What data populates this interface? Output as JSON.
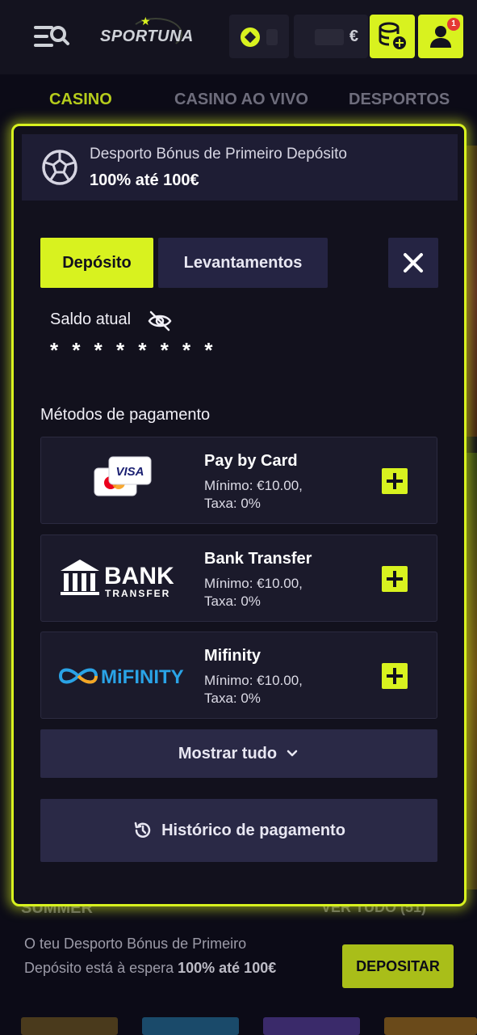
{
  "header": {
    "brand": "SPORTUNA",
    "balance_currency": "€",
    "notification_count": "1"
  },
  "nav": {
    "items": [
      "CASINO",
      "CASINO AO VIVO",
      "DESPORTOS"
    ],
    "active": "CASINO"
  },
  "modal": {
    "bonus": {
      "title": "Desporto Bónus de Primeiro Depósito",
      "value": "100% até 100€"
    },
    "tabs": {
      "deposit": "Depósito",
      "withdraw": "Levantamentos",
      "active": "Depósito"
    },
    "balance": {
      "label": "Saldo atual",
      "value": "* * * * * * * *"
    },
    "methods_title": "Métodos de pagamento",
    "methods": [
      {
        "name": "Pay by Card",
        "min": "Mínimo: €10.00,",
        "fee": "Taxa: 0%",
        "logo_visa": "VISA"
      },
      {
        "name": "Bank Transfer",
        "min": "Mínimo: €10.00,",
        "fee": "Taxa: 0%",
        "logo_line1": "BANK",
        "logo_line2": "TRANSFER"
      },
      {
        "name": "Mifinity",
        "min": "Mínimo: €10.00,",
        "fee": "Taxa: 0%",
        "logo_text": "MiFINITY"
      }
    ],
    "show_all": "Mostrar tudo",
    "history": "Histórico de pagamento"
  },
  "background": {
    "section_title": "SUMMER",
    "section_link": "VER TUDO (51)",
    "promo_text_1": "O teu Desporto Bónus de Primeiro Depósito está à espera ",
    "promo_text_bold": "100% até 100€",
    "deposit_cta": "DEPOSITAR"
  },
  "colors": {
    "accent": "#d8f21f",
    "panel": "#12111d",
    "card": "#1b1a2b",
    "button_dark": "#2a2946"
  }
}
